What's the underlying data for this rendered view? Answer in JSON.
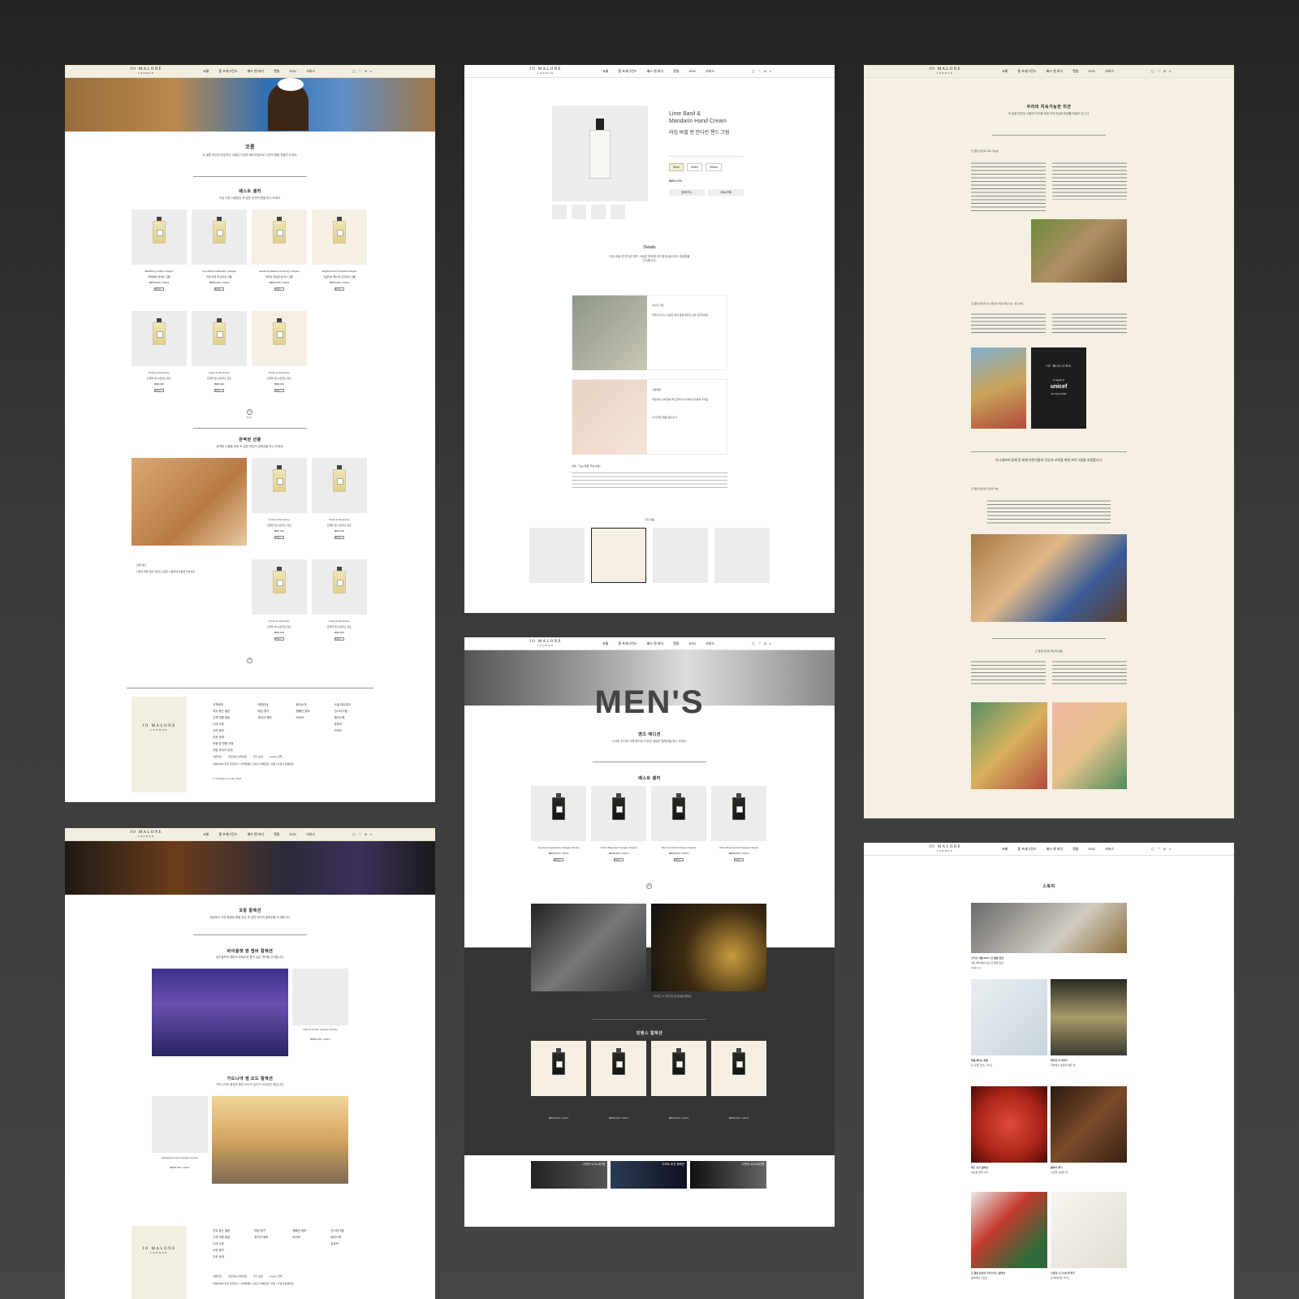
{
  "brand": {
    "logo_line1": "JO MALONE",
    "logo_line2": "LONDON"
  },
  "nav": {
    "items": [
      "코롱",
      "홈 프래그런스",
      "배스 앤 바디",
      "캔들",
      "ESG",
      "서비스"
    ],
    "icons": [
      "bag-icon",
      "heart-icon",
      "user-icon",
      "search-icon"
    ]
  },
  "cologne": {
    "title": "코롱",
    "desc": "조 말론 런던의 상징적인 코롱은 다양한 레이어링으로 나만의 향을 만들어 보세요."
  },
  "best": {
    "title": "베스트 셀러",
    "desc": "지금 가장 사랑받는 조 말론 런던의 향을 만나 보세요.",
    "products": [
      {
        "name": "Blackberry & Bay Cologne",
        "sub": "블랙베리 앤 베이 코롱",
        "price": "₩235,000 / 100ml"
      },
      {
        "name": "Lime Basil & Mandarin Cologne",
        "sub": "라임 바질 앤 만다린 코롱",
        "price": "₩235,000 / 100ml"
      },
      {
        "name": "Nectarine Blossom & Honey Cologne",
        "sub": "넥타린 블로섬 앤 허니 코롱",
        "price": "₩235,000 / 100ml"
      },
      {
        "name": "English Pear & Freesia Cologne",
        "sub": "잉글리쉬 페어 앤 프리지아 코롱",
        "price": "₩235,000 / 100ml"
      },
      {
        "name": "Fruity & Citrus Duo",
        "sub": "프루티 앤 시트러스 듀오",
        "price": "₩90,000"
      },
      {
        "name": "Fruity & Citrus Duo",
        "sub": "프루티 앤 시트러스 듀오",
        "price": "₩90,000"
      },
      {
        "name": "Fruity & Citrus Duo",
        "sub": "프루티 앤 시트러스 듀오",
        "price": "₩90,000"
      }
    ],
    "button": "장바구니"
  },
  "gift": {
    "title": "완벽한 선물",
    "desc": "완벽한 선물을 위한 조 말론 런던의 컬렉션을 만나 보세요.",
    "caption_title": "선물 제안",
    "caption": "다양한 향을 담은 세트로 소중한 사람에게 마음을 전하세요.",
    "products": [
      {
        "name": "Fruity & Citrus Duo",
        "sub": "프루티 앤 시트러스 듀오",
        "price": "₩90,000"
      },
      {
        "name": "Fruity & Citrus Duo",
        "sub": "프루티 앤 시트러스 듀오",
        "price": "₩90,000"
      },
      {
        "name": "Fruity & Citrus Duo",
        "sub": "프루티 앤 시트러스 듀오",
        "price": "₩90,000"
      },
      {
        "name": "Fruity & Citrus Duo",
        "sub": "프루티 앤 시트러스 듀오",
        "price": "₩90,000"
      }
    ]
  },
  "more": "더보기",
  "footer": {
    "cols": [
      {
        "title": "고객센터",
        "items": [
          "자주 묻는 질문",
          "고객 지원 채널",
          "나의 주문",
          "나의 정보",
          "주문 상태",
          "보증 및 반품 규정",
          "관련 부티크 검색"
        ]
      },
      {
        "title": "매장안내",
        "items": [
          "매장 찾기",
          "부티크 예약"
        ]
      },
      {
        "title": "회사소개",
        "items": [
          "캠페인 정보",
          "커리어"
        ]
      },
      {
        "title": "소셜 네트워크",
        "items": [
          "인스타그램",
          "페이스북",
          "유튜브",
          "카카오"
        ]
      }
    ],
    "links": [
      "이용약관",
      "개인정보 처리방침",
      "쿠키 설정",
      "Cookie 정책"
    ],
    "copyright": "© Jo Malone London 2024",
    "legal": "이엘씨에이 한국 유한회사 | 서울특별시 강남구 테헤란로 | 대표 | 사업자 등록번호"
  },
  "pdp": {
    "name_en": "Lime Basil &\nMandarin Hand Cream",
    "name_kr": "라임 바질 앤 만다린 핸드 크림",
    "sizes": [
      "50ml",
      "100ml",
      "300ml"
    ],
    "price": "₩54,000",
    "btn_cart": "장바구니",
    "btn_buy": "바로구매",
    "details_title": "Details",
    "details_text": "라임 바질 앤 만다린 핸드 크림은 피부에 부드럽게 흡수되어 촉촉함을 선사합니다.",
    "feature1_title": "어디서 가든",
    "feature1_text": "언제 어디서나 상큼한 향과 함께 촉촉한 손을 유지하세요.",
    "feature2_title": "사용방법",
    "feature2_text": "적당량을 손에 덜어 부드럽게 마사지하듯 펴 발라 주세요.",
    "feature2_link": "더 자세한 제품 정보 보기",
    "ingredients_title": "성분 - 기능 (제품, 핵심 성분)",
    "related_title": "추천 상품"
  },
  "esg": {
    "title": "우리의 지속가능한 미션",
    "desc": "조 말론 런던은 사람과 지구를 위한 지속가능한 미래를 만들어 갑니다.",
    "s1_title": "조 말론 런던의 지속 가능성",
    "s2_title": "조 말론 런던과 유니세프의 지속 파트너십 - 유니세프",
    "unicef_brand": "JO MALONE",
    "unicef_tag": "in support of",
    "unicef_logo": "unicef",
    "unicef_sub": "for every child",
    "quote": "유니세프와 함께 전 세계 어린이들의 건강과 교육을 위한 프로그램을 지원합니다.",
    "s3_title": "조 말론 런던의 자선적 약속",
    "s4_title": "조 말론 런던의 재단의 활동"
  },
  "mens": {
    "hero": "MEN'S",
    "title": "맨즈 에디션",
    "desc": "시크한 우디와 가죽 향으로 구성된 새로운 컬렉션을 만나 보세요.",
    "best_title": "베스트 셀러",
    "products": [
      {
        "name": "Cypress & Grapevine Cologne Intense",
        "price": "₩280,000 / 100ml"
      },
      {
        "name": "Oud & Bergamot Cologne Intense",
        "price": "₩280,000 / 100ml"
      },
      {
        "name": "Myrrh & Tonka Cologne Intense",
        "price": "₩280,000 / 100ml"
      },
      {
        "name": "Velvet Rose & Oud Cologne Intense",
        "price": "₩280,000 / 100ml"
      }
    ],
    "feature_caption": "시더우드 & 가죽 향으로 완성된 컬렉션",
    "collection_title": "인텐스 컬렉션",
    "tiles": [
      "나만의 시그니처 향",
      "기프트 추천 컬렉션",
      "나만의 시그니처 향"
    ],
    "button": "장바구니"
  },
  "collection": {
    "title": "코롱 컬렉션",
    "desc": "세상에서 가장 특별한 향을 담은 조 말론 런던의 컬렉션을 소개합니다.",
    "s1_title": "바이올렛 앤 앰버 컬렉션",
    "s1_desc": "바이올렛과 앰버의 조화로운 향이 깊은 매력을 선사합니다.",
    "s2_title": "가드니아 앤 오드 컬렉션",
    "s2_desc": "가드니아의 풍성한 향과 오드의 깊이가 어우러진 향입니다.",
    "product1": "Violet & Amber Cologne Intense",
    "product2": "Gardenia & Oud Cologne Intense",
    "price": "₩280,000 / 100ml"
  },
  "stories": {
    "title": "스토리",
    "items": [
      {
        "title": "프리즈 서울 2024 | 조 말론 런던",
        "sub": "아트 페어에서 만난 조 말론 런던"
      },
      {
        "title": "향을 채우는 방법",
        "sub": "홈 프래그런스 가이드"
      },
      {
        "title": "대자연 속 이야기",
        "sub": "자연에서 영감을 받은 향"
      },
      {
        "title": "레드 로즈 컬렉션",
        "sub": "새로운 향의 시작"
      },
      {
        "title": "클래식 향기",
        "sub": "시간을 초월한 향"
      },
      {
        "title": "조 말론 런던의 크리스마스 컬렉션",
        "sub": "홀리데이 기프트"
      },
      {
        "title": "나만의 시그니처 향 찾기",
        "sub": "향 레이어링 가이드"
      }
    ],
    "more": "자세히 보기"
  }
}
